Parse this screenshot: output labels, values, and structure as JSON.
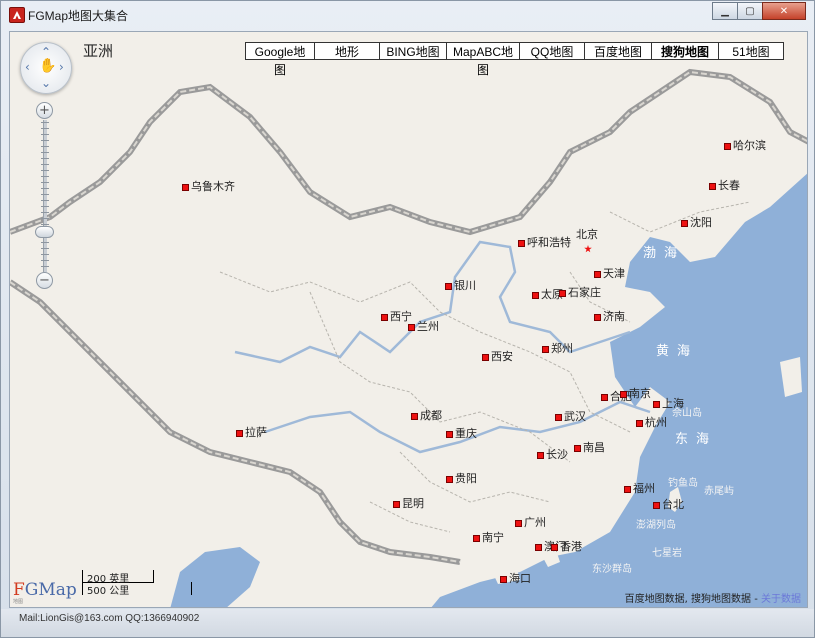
{
  "window": {
    "title": "FGMap地图大集合"
  },
  "map_tabs": [
    "Google地图",
    "地形",
    "BING地图",
    "MapABC地图",
    "QQ地图",
    "百度地图",
    "搜狗地图",
    "51地图"
  ],
  "active_tab": "搜狗地图",
  "region_label": "亚洲",
  "zoom": {
    "plus": "+",
    "minus": "−"
  },
  "cities": [
    {
      "name": "哈尔滨"
    },
    {
      "name": "长春"
    },
    {
      "name": "沈阳"
    },
    {
      "name": "乌鲁木齐"
    },
    {
      "name": "呼和浩特"
    },
    {
      "name": "北京"
    },
    {
      "name": "天津"
    },
    {
      "name": "太原"
    },
    {
      "name": "石家庄"
    },
    {
      "name": "银川"
    },
    {
      "name": "西宁"
    },
    {
      "name": "兰州"
    },
    {
      "name": "济南"
    },
    {
      "name": "郑州"
    },
    {
      "name": "西安"
    },
    {
      "name": "合肥"
    },
    {
      "name": "南京"
    },
    {
      "name": "上海"
    },
    {
      "name": "成都"
    },
    {
      "name": "武汉"
    },
    {
      "name": "杭州"
    },
    {
      "name": "拉萨"
    },
    {
      "name": "重庆"
    },
    {
      "name": "长沙"
    },
    {
      "name": "南昌"
    },
    {
      "name": "贵阳"
    },
    {
      "name": "福州"
    },
    {
      "name": "台北"
    },
    {
      "name": "昆明"
    },
    {
      "name": "广州"
    },
    {
      "name": "南宁"
    },
    {
      "name": "澳门"
    },
    {
      "name": "香港"
    },
    {
      "name": "海口"
    }
  ],
  "seas": {
    "bohai": "渤海",
    "yellow": "黄海",
    "east": "东海"
  },
  "islands": [
    "佘山岛",
    "钓鱼岛",
    "赤尾屿",
    "澎湖列岛",
    "七星岩",
    "东沙群岛"
  ],
  "scale": {
    "miles": "200 英里",
    "km": "500 公里"
  },
  "logo": {
    "text": "FGMap",
    "caption": "地图"
  },
  "copyright": {
    "text": "百度地图数据, 搜狗地图数据 - ",
    "link": "关于数据"
  },
  "status": {
    "text": "Mail:LionGis@163.com   QQ:1366940902"
  }
}
